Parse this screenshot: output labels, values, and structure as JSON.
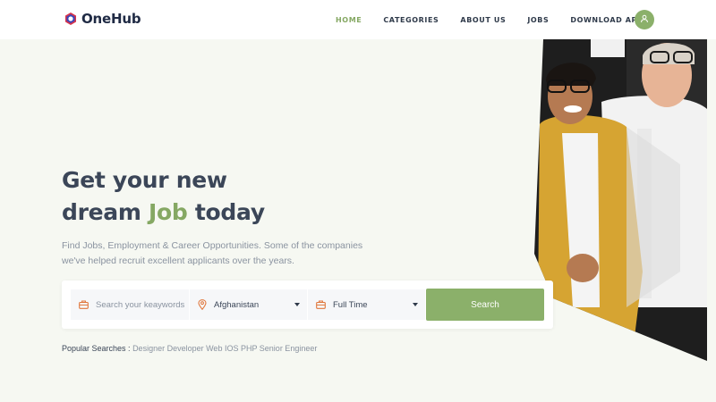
{
  "brand": {
    "name": "OneHub"
  },
  "nav": [
    {
      "label": "HOME",
      "active": true
    },
    {
      "label": "CATEGORIES",
      "active": false
    },
    {
      "label": "ABOUT US",
      "active": false
    },
    {
      "label": "JOBS",
      "active": false
    },
    {
      "label": "DOWNLOAD APPS",
      "active": false
    }
  ],
  "hero": {
    "headline_line1": "Get your new",
    "headline_line2_pre": "dream ",
    "headline_accent": "Job",
    "headline_line2_post": " today",
    "subtext": "Find Jobs, Employment & Career Opportunities. Some of the companies we've helped recruit excellent applicants over the years."
  },
  "search": {
    "keyword_placeholder": "Search your keaywords",
    "location_value": "Afghanistan",
    "type_value": "Full Time",
    "button_label": "Search"
  },
  "popular": {
    "label": "Popular Searches :",
    "tags": "Designer Developer Web IOS PHP Senior Engineer"
  },
  "colors": {
    "accent": "#85a863",
    "button": "#8bb06a",
    "heading": "#3b4658",
    "muted": "#8a93a0",
    "hero_bg": "#f6f8f2"
  },
  "icons": {
    "avatar": "user-icon",
    "keyword": "briefcase-icon",
    "location": "map-pin-icon",
    "type": "briefcase-icon"
  }
}
